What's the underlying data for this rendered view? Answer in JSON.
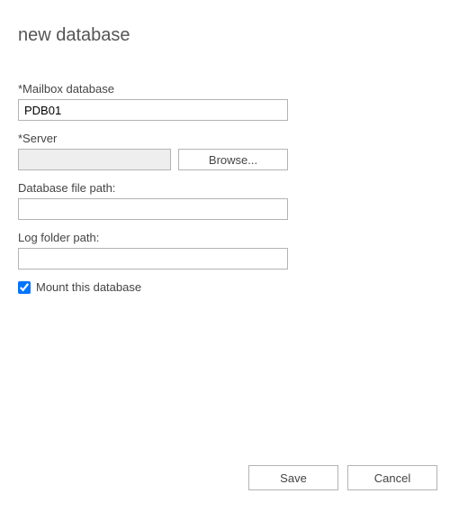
{
  "title": "new database",
  "fields": {
    "mailbox_db": {
      "label": "*Mailbox database",
      "value": "PDB01"
    },
    "server": {
      "label": "*Server",
      "value": "",
      "browse_label": "Browse..."
    },
    "db_file_path": {
      "label": "Database file path:",
      "value": ""
    },
    "log_folder_path": {
      "label": "Log folder path:",
      "value": ""
    },
    "mount": {
      "label": "Mount this database",
      "checked": true
    }
  },
  "footer": {
    "save_label": "Save",
    "cancel_label": "Cancel"
  }
}
